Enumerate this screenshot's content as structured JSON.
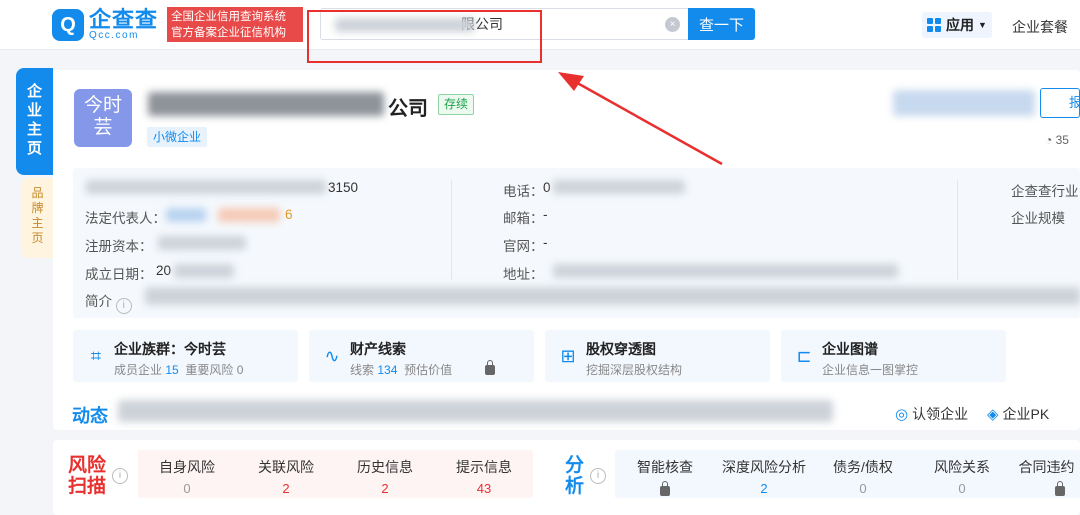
{
  "brand": {
    "logo_mark": "Q",
    "name_cn": "企查查",
    "name_en": "Qcc.com",
    "slogan_line1": "全国企业信用查询系统",
    "slogan_line2": "官方备案企业征信机构"
  },
  "search": {
    "value": "限公司",
    "button_label": "查一下",
    "clear_icon": "×"
  },
  "header": {
    "app_label": "应用",
    "package_label": "企业套餐"
  },
  "side_tabs": {
    "main": "企业主页",
    "brand": "品牌主页"
  },
  "company": {
    "avatar_text": "今时芸",
    "name_tail": "公司",
    "status": "存续",
    "scale_tag": "小微企业",
    "report_label": "报",
    "follow_count": "35"
  },
  "info": {
    "code_tail": "3150",
    "legal_rep_label": "法定代表人：",
    "legal_rep_count": "6",
    "reg_capital_label": "注册资本：",
    "founded_label": "成立日期：",
    "founded_prefix": "20",
    "intro_label": "简介",
    "phone_label": "电话：",
    "phone_prefix": "0",
    "email_label": "邮箱：",
    "email_value": "-",
    "website_label": "官网：",
    "website_value": "-",
    "address_label": "地址：",
    "industry_label": "企查查行业",
    "size_label": "企业规模"
  },
  "features": [
    {
      "title": "企业族群：今时芸",
      "sub_a": "成员企业",
      "sub_a_val": "15",
      "sub_b": "重要风险 0"
    },
    {
      "title": "财产线索",
      "sub_a": "线索",
      "sub_a_val": "134",
      "sub_b": "预估价值"
    },
    {
      "title": "股权穿透图",
      "sub_a": "挖掘深层股权结构",
      "sub_a_val": "",
      "sub_b": ""
    },
    {
      "title": "企业图谱",
      "sub_a": "企业信息一图掌控",
      "sub_a_val": "",
      "sub_b": ""
    }
  ],
  "dynamic": {
    "label": "动态",
    "claim_label": "认领企业",
    "pk_label": "企业PK"
  },
  "risk": {
    "label": "风险扫描",
    "items": [
      {
        "title": "自身风险",
        "count": "0"
      },
      {
        "title": "关联风险",
        "count": "2"
      },
      {
        "title": "历史信息",
        "count": "2"
      },
      {
        "title": "提示信息",
        "count": "43"
      }
    ]
  },
  "analysis": {
    "label": "分析",
    "items": [
      {
        "title": "智能核查",
        "count": ""
      },
      {
        "title": "深度风险分析",
        "count": "2"
      },
      {
        "title": "债务/债权",
        "count": "0"
      },
      {
        "title": "风险关系",
        "count": "0"
      },
      {
        "title": "合同违约",
        "count": ""
      }
    ]
  }
}
